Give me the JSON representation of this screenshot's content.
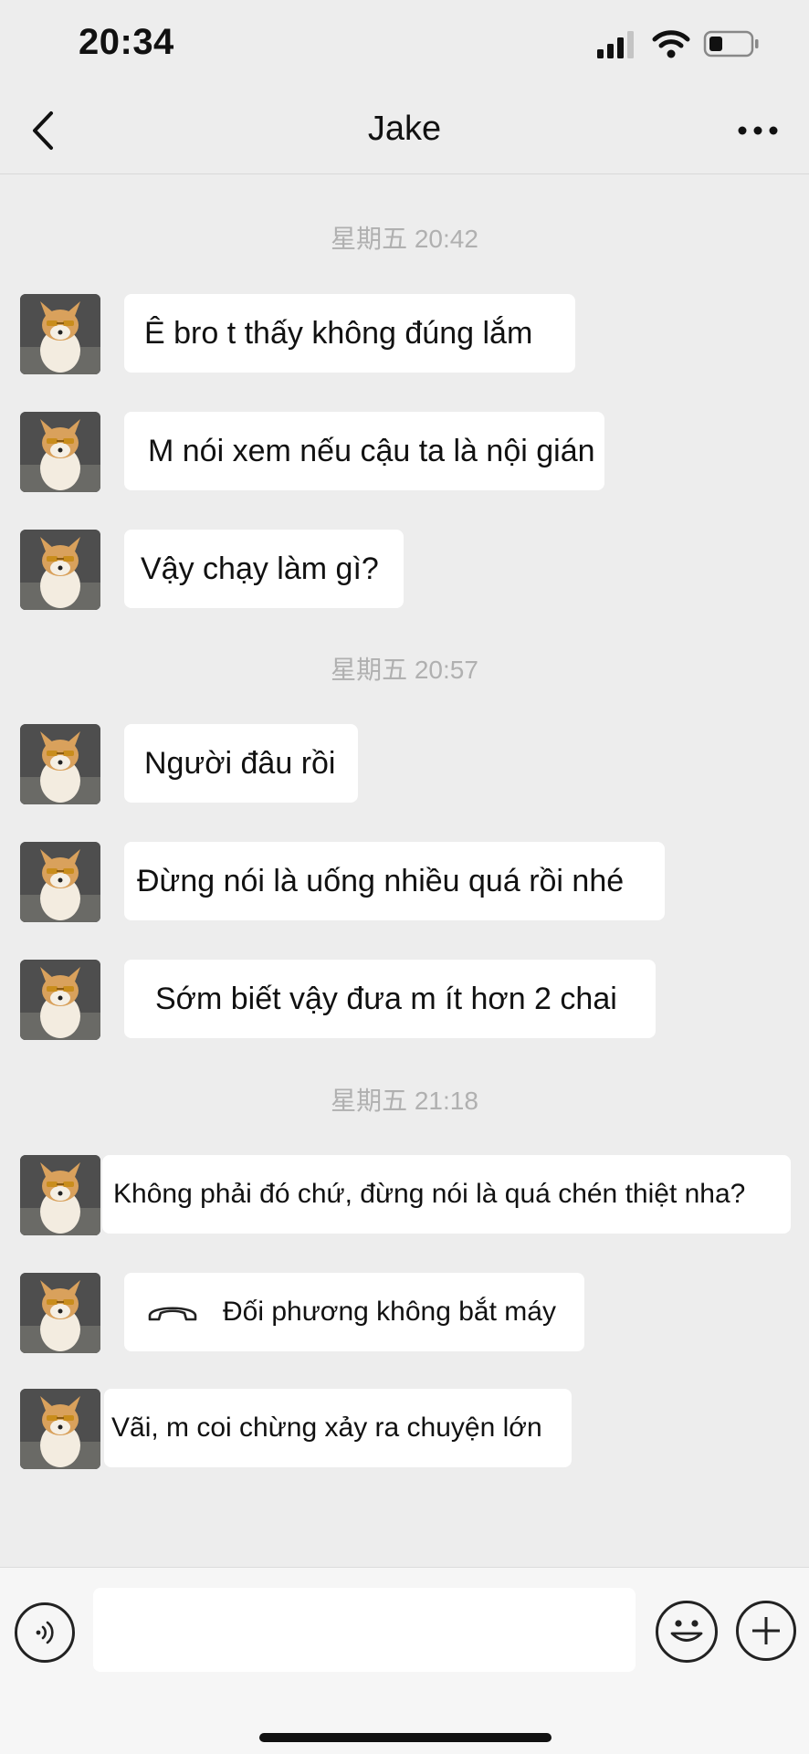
{
  "status_bar": {
    "time": "20:34"
  },
  "header": {
    "title": "Jake"
  },
  "chat": {
    "separators": [
      {
        "text": "星期五 20:42"
      },
      {
        "text": "星期五 20:57"
      },
      {
        "text": "星期五 21:18"
      }
    ],
    "messages": [
      {
        "text": "Ê bro t thấy không đúng lắm"
      },
      {
        "text": "M nói xem nếu cậu ta là nội gián"
      },
      {
        "text": "Vậy chạy làm gì?"
      },
      {
        "text": "Người đâu rồi"
      },
      {
        "text": "Đừng nói là uống nhiều quá rồi nhé"
      },
      {
        "text": "Sớm biết vậy đưa m ít hơn 2 chai"
      },
      {
        "text": "Không phải đó chứ, đừng nói là quá chén thiệt nha?"
      },
      {
        "text": "Đối phương không bắt máy",
        "icon": "hang-up-phone-icon"
      },
      {
        "text": "Vãi, m coi chừng xảy ra chuyện lớn"
      }
    ]
  },
  "input_bar": {
    "placeholder": "",
    "value": ""
  },
  "colors": {
    "background": "#ededed",
    "bubble": "#ffffff",
    "timestamp": "#b0b0b0"
  }
}
